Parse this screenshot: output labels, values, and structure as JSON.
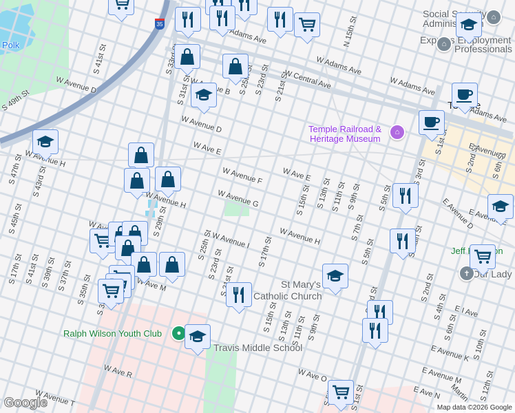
{
  "map": {
    "attribution": "Map data ©2026 Google",
    "logo": "Google",
    "interstate": "35",
    "colors": {
      "marker_bg": "#e6edfd",
      "marker_border": "#6b96dd",
      "icon": "#0b4a6f",
      "park": "#c5f0d5",
      "water": "#8fd7ef",
      "highway": "#8da3c4"
    },
    "labels": {
      "polk": "Polk",
      "s41": "S 41st St",
      "wavd": "W Avenue D",
      "s49": "S 49th St",
      "s33": "S 33rd St",
      "s31": "S 31st St",
      "wavb": "W Avenue B",
      "s25a": "S 25th St",
      "wadams1": "W Adams Ave",
      "wavd2": "W Avenue D",
      "wavee": "W Ave E",
      "wavh1": "W Avenue H",
      "s43": "S 43rd St",
      "s47": "S 47th St",
      "wavf": "W Avenue F",
      "wavg": "W Avenue G",
      "wavh2": "W Avenue H",
      "s29": "S 29th St",
      "s23a": "S 23rd St",
      "s21a": "S 21st St",
      "n15": "N 15th St",
      "wadams2": "W Adams Ave",
      "wcentral": "W Central Ave",
      "wadams3": "W Adams Ave",
      "temple": "Temple",
      "eadams": "E Adams Ave",
      "s1": "S 1st St",
      "s2a": "S 2nd St",
      "eavj": "E Avenue J",
      "s6a": "S 6th St",
      "s3": "S 3rd St",
      "wavee2": "W Ave E",
      "s15a": "S 15th St",
      "s13a": "S 13th St",
      "s11a": "S 11th St",
      "s9a": "S 9th St",
      "s5a": "S 5th St",
      "eavd": "E Avenue D",
      "eave": "E Avenue E",
      "s45": "S 45th St",
      "wavi": "W Avenue I",
      "s25b": "S 25th St",
      "s23b": "S 23rd St",
      "s21b": "S 21st St",
      "s41b": "S 41st St",
      "s39": "S 39th St",
      "s37": "S 37th St",
      "s35": "S 35th St",
      "s33b": "S 33rd St",
      "wavm": "W Ave M",
      "wavl": "W Ave L",
      "wavr": "W Ave R",
      "wavt": "W Avenue T",
      "s17a": "S 17th St",
      "s7": "S 7th St",
      "s5b": "S 5th St",
      "smain": "S Main St",
      "wavh3": "W Avenue H",
      "s17b": "S 17th St",
      "s15b": "S 15th St",
      "s13b": "S 13th St",
      "s11b": "S 11th St",
      "s9b": "S 9th St",
      "s3b": "S 3rd St",
      "s2b": "S 2nd St",
      "s4": "S 4th St",
      "s6b": "S 6th St",
      "s10": "S 10th St",
      "s12": "S 12th St",
      "eiave": "E I Ave",
      "eavk": "E Avenue K",
      "eavm": "E Avenue M",
      "eavn": "E Ave N",
      "wavo": "W Ave O",
      "s5c": "S 5th St",
      "s1b": "S 1st St",
      "martin": "Martin",
      "stmarys1": "St Mary's",
      "stmarys2": "Catholic Church",
      "travis": "Travis Middle School",
      "ralph": "Ralph Wilson Youth Club",
      "museum1": "Temple Railroad &",
      "museum2": "Heritage Museum",
      "ssa1": "Social Security",
      "ssa2": "Administration",
      "express1": "Express Employment",
      "express2": "Professionals",
      "jeff": "Jeff Hamilton",
      "ourlady": "Our Lady"
    },
    "markers": [
      "cart",
      "food",
      "food",
      "food",
      "food",
      "food",
      "cart",
      "bag",
      "bag",
      "cap",
      "cap",
      "bag",
      "bag",
      "bag",
      "cap",
      "coffee",
      "coffee",
      "food",
      "cap",
      "food",
      "cart",
      "cap",
      "food",
      "food",
      "cart",
      "food",
      "cap",
      "cart",
      "bag",
      "bag",
      "bag",
      "bag",
      "bag",
      "cart",
      "cart",
      "cart"
    ]
  }
}
